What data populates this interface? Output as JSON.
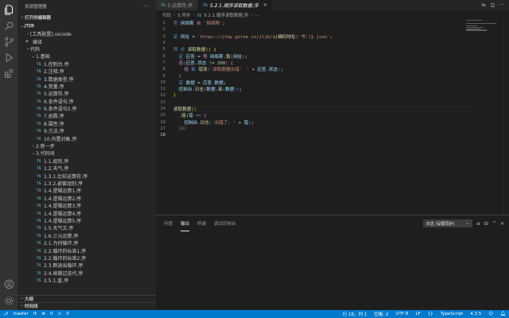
{
  "activity_bar": {
    "icons": [
      "files-icon",
      "search-icon",
      "source-control-icon",
      "run-debug-icon",
      "extensions-icon"
    ],
    "bottom_icons": [
      "account-icon",
      "settings-gear-icon"
    ]
  },
  "sidebar": {
    "title": "资源管理器",
    "open_editors_label": "打开的编辑器",
    "root_label": "JTJB",
    "tree": [
      {
        "label": "[工具配置].vscode",
        "depth": 1,
        "kind": "folder",
        "open": false
      },
      {
        "label": "编译",
        "depth": 1,
        "kind": "gitignore"
      },
      {
        "label": "代码",
        "depth": 1,
        "kind": "folder",
        "open": true
      },
      {
        "label": "1.基础",
        "depth": 2,
        "kind": "folder",
        "open": true
      },
      {
        "label": "1.控制台.序",
        "depth": 3,
        "kind": "ts"
      },
      {
        "label": "2.注释.序",
        "depth": 3,
        "kind": "ts"
      },
      {
        "label": "3.数据类型.序",
        "depth": 3,
        "kind": "ts"
      },
      {
        "label": "4.变量.序",
        "depth": 3,
        "kind": "ts"
      },
      {
        "label": "5.运算符.序",
        "depth": 3,
        "kind": "ts"
      },
      {
        "label": "6.条件语句.序",
        "depth": 3,
        "kind": "ts"
      },
      {
        "label": "6.条件语句2.序",
        "depth": 3,
        "kind": "ts"
      },
      {
        "label": "7.函数.序",
        "depth": 3,
        "kind": "ts"
      },
      {
        "label": "8.属性.序",
        "depth": 3,
        "kind": "ts"
      },
      {
        "label": "9.方法.序",
        "depth": 3,
        "kind": "ts"
      },
      {
        "label": "10.内置对象.序",
        "depth": 3,
        "kind": "ts"
      },
      {
        "label": "2.新一步",
        "depth": 2,
        "kind": "folder",
        "open": false
      },
      {
        "label": "3.代码块",
        "depth": 2,
        "kind": "folder",
        "open": true
      },
      {
        "label": "1.1.组别.序",
        "depth": 3,
        "kind": "ts"
      },
      {
        "label": "1.2.天气.序",
        "depth": 3,
        "kind": "ts"
      },
      {
        "label": "1.3.1.比较运算符.序",
        "depth": 3,
        "kind": "ts"
      },
      {
        "label": "1.3.2.嵌套组别.序",
        "depth": 3,
        "kind": "ts"
      },
      {
        "label": "1.4.逻辑运算1.序",
        "depth": 3,
        "kind": "ts"
      },
      {
        "label": "1.4.逻辑运算2.序",
        "depth": 3,
        "kind": "ts"
      },
      {
        "label": "1.4.逻辑运算3.序",
        "depth": 3,
        "kind": "ts"
      },
      {
        "label": "1.4.逻辑运算4.序",
        "depth": 3,
        "kind": "ts"
      },
      {
        "label": "1.4.逻辑运算5.序",
        "depth": 3,
        "kind": "ts"
      },
      {
        "label": "1.5.天气文.序",
        "depth": 3,
        "kind": "ts"
      },
      {
        "label": "1.6.三元运算.序",
        "depth": 3,
        "kind": "ts"
      },
      {
        "label": "2.1.为何循环.序",
        "depth": 3,
        "kind": "ts"
      },
      {
        "label": "2.2.循环的标准1.序",
        "depth": 3,
        "kind": "ts"
      },
      {
        "label": "2.2.循环的标准2.序",
        "depth": 3,
        "kind": "ts"
      },
      {
        "label": "2.3.断退出循环.序",
        "depth": 3,
        "kind": "ts"
      },
      {
        "label": "2.4.续跳过迭代.序",
        "depth": 3,
        "kind": "ts"
      },
      {
        "label": "2.5.1.直.序",
        "depth": 3,
        "kind": "ts"
      }
    ],
    "outline_label": "大纲",
    "timeline_label": "时间线"
  },
  "editor": {
    "tabs": [
      {
        "label": "5.运算符.序",
        "active": false
      },
      {
        "label": "5.2.1.顺序读取数据.序",
        "active": true
      }
    ],
    "breadcrumb": [
      "代码",
      "5.异步",
      "5.2.1.顺序读取数据.序",
      "..."
    ],
    "code_lines": [
      {
        "n": "1",
        "html": "<span class='kw'>引</span> <span class='vr'>网络斯</span> <span class='kw'>自</span> <span class='str'>'网络斯'</span><span class='op'>;</span>"
      },
      {
        "n": "2",
        "html": ""
      },
      {
        "n": "3",
        "html": "<span class='decl'>定</span> <span class='vr'>网址</span> <span class='op'>=</span> <span class='str'>`https://jtmy.gitee.io/jtjb/$</span><span class='br1'>{</span><span class='fn'>编码地址</span><span class='br2'>(</span><span class='str'>'书'</span><span class='br2'>)</span><span class='br1'>}</span><span class='str'>.json`</span><span class='op'>;</span>"
      },
      {
        "n": "4",
        "html": ""
      },
      {
        "n": "5",
        "html": "<span class='decl'>异 步</span> <span class='fn'>读取数据</span><span class='br1'>()</span> <span class='br1'>{</span>"
      },
      {
        "n": "6",
        "html": "  <span class='decl'>定</span> <span class='vr'>应答</span> <span class='op'>=</span> <span class='kw'>等</span> <span class='vr'>网络斯</span><span class='op'>.</span><span class='fn'>取</span><span class='br2'>(</span><span class='vr'>网址</span><span class='br2'>)</span><span class='op'>;</span>"
      },
      {
        "n": "7",
        "html": "  <span class='kw'>若</span><span class='br2'>(</span><span class='vr'>应答</span><span class='op'>.</span><span class='vr'>状态</span> <span class='op'>!=</span> <span class='num'>200</span><span class='br2'>)</span> <span class='br2'>{</span>"
      },
      {
        "n": "8",
        "html": "    <span class='kw'>抛</span> <span class='decl'>新</span> <span class='fn'>错误</span><span class='br3'>(</span><span class='str'>'读取数据出错： '</span> <span class='op'>+</span> <span class='vr'>应答</span><span class='op'>.</span><span class='vr'>状态</span><span class='br3'>)</span><span class='op'>;</span>"
      },
      {
        "n": "9",
        "html": "  <span class='br2'>}</span>"
      },
      {
        "n": "10",
        "html": "  <span class='decl'>定</span> <span class='vr'>数据</span> <span class='op'>=</span> <span class='vr'>应答</span><span class='op'>.</span><span class='vr'>数据</span><span class='op'>;</span>"
      },
      {
        "n": "11",
        "html": "  <span class='vr'>控制台</span><span class='op'>.</span><span class='fn'>日志</span><span class='br2'>(</span><span class='vr'>数据</span><span class='op'>.</span><span class='fn'>串</span><span class='br3'>(</span><span class='vr'>数据</span><span class='br3'>)</span><span class='br2'>)</span><span class='op'>;</span>"
      },
      {
        "n": "12",
        "html": "<span class='br1'>}</span>"
      },
      {
        "n": "13",
        "html": ""
      },
      {
        "n": "14",
        "html": "<span class='fn'>读取数据</span><span class='br1'>()</span>"
      },
      {
        "n": "15",
        "html": "  <span class='op'>.</span><span class='fn'>接</span><span class='br1'>(</span><span class='vr'>错</span> <span class='decl'>=&gt;</span> <span class='br2'>{</span>"
      },
      {
        "n": "16",
        "html": "    <span class='vr'>控制台</span><span class='op'>.</span><span class='fn'>日志</span><span class='br3'>(</span><span class='str'>'出错了: '</span> <span class='op'>+</span> <span class='vr'>错</span><span class='br3'>)</span><span class='op'>;</span>"
      },
      {
        "n": "17",
        "html": "  <span class='br2'>}</span><span class='br1'>)</span><span class='op'>;</span>"
      },
      {
        "n": "18",
        "html": ""
      }
    ]
  },
  "panel": {
    "tabs": [
      {
        "label": "问题",
        "active": false
      },
      {
        "label": "输出",
        "active": true
      },
      {
        "label": "终端",
        "active": false
      },
      {
        "label": "调试控制台",
        "active": false
      }
    ],
    "output_channel": "日志 (设置同步)"
  },
  "status_bar": {
    "branch": "master",
    "errors": "0",
    "warnings": "0",
    "cursor_position": "行 18，列 1",
    "indent": "空格: 2",
    "encoding": "UTF-8",
    "eol": "LF",
    "language": "TypeScript",
    "version": "4.3.5"
  }
}
